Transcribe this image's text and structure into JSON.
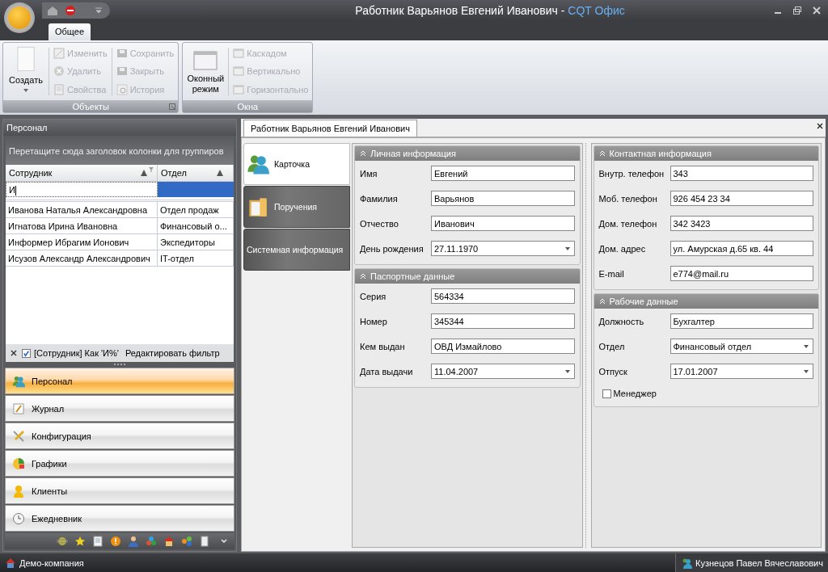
{
  "window": {
    "title": "Работник Варьянов Евгений Иванович - ",
    "app_name": "CQT Офис"
  },
  "ribbon": {
    "tabs": [
      {
        "label": "Общее",
        "selected": true
      }
    ],
    "groups": [
      {
        "label": "Объекты",
        "large": [
          {
            "label": "Создать",
            "disabled": false
          }
        ],
        "columns": [
          [
            {
              "label": "Изменить",
              "disabled": true,
              "kind": "edit"
            },
            {
              "label": "Удалить",
              "disabled": true,
              "kind": "delete"
            },
            {
              "label": "Свойства",
              "disabled": true,
              "kind": "props"
            }
          ],
          [
            {
              "label": "Сохранить",
              "disabled": true,
              "kind": "save"
            },
            {
              "label": "Закрыть",
              "disabled": true,
              "kind": "save"
            },
            {
              "label": "История",
              "disabled": true,
              "kind": "history"
            }
          ]
        ]
      },
      {
        "label": "Окна",
        "large": [
          {
            "label": "Оконный режим",
            "disabled": false
          }
        ],
        "columns": [
          [
            {
              "label": "Каскадом",
              "disabled": true,
              "kind": "window"
            },
            {
              "label": "Вертикально",
              "disabled": true,
              "kind": "window"
            },
            {
              "label": "Горизонтально",
              "disabled": true,
              "kind": "window"
            }
          ]
        ]
      }
    ]
  },
  "left_panel": {
    "title": "Персонал",
    "group_hint": "Перетащите сюда заголовок колонки для группиров",
    "columns": [
      {
        "label": "Сотрудник"
      },
      {
        "label": "Отдел"
      }
    ],
    "filter_row": [
      {
        "value": "И",
        "selected": false
      },
      {
        "selected": true
      }
    ],
    "rows": [
      [
        "Иванова Наталья Александровна",
        "Отдел продаж"
      ],
      [
        "Игнатова Ирина Ивановна",
        "Финансовый о..."
      ],
      [
        "Информер Ибрагим Ионович",
        "Экспедиторы"
      ],
      [
        "Исузов Александр Александрович",
        "IT-отдел"
      ]
    ],
    "filter_bar": {
      "checked": true,
      "text": "[Сотрудник] Как 'И%'",
      "edit_link": "Редактировать фильтр"
    },
    "nav": [
      {
        "label": "Персонал",
        "selected": true,
        "kind": "people"
      },
      {
        "label": "Журнал",
        "selected": false,
        "kind": "journal"
      },
      {
        "label": "Конфигурация",
        "selected": false,
        "kind": "tools"
      },
      {
        "label": "Графики",
        "selected": false,
        "kind": "chart"
      },
      {
        "label": "Клиенты",
        "selected": false,
        "kind": "person"
      },
      {
        "label": "Ежедневник",
        "selected": false,
        "kind": "clock"
      }
    ]
  },
  "document": {
    "tab": "Работник Варьянов Евгений Иванович",
    "side_tabs": [
      {
        "label": "Карточка",
        "selected": true,
        "kind": "people"
      },
      {
        "label": "Поручения",
        "selected": false,
        "kind": "folder"
      },
      {
        "label": "Системная информация",
        "selected": false,
        "kind": "plain"
      }
    ],
    "columns": [
      [
        {
          "title": "Личная информация",
          "fields": [
            {
              "label": "Имя",
              "value": "Евгений",
              "kind": "text"
            },
            {
              "label": "Фамилия",
              "value": "Варьянов",
              "kind": "text"
            },
            {
              "label": "Отчество",
              "value": "Иванович",
              "kind": "text"
            },
            {
              "label": "День рождения",
              "value": "27.11.1970",
              "kind": "combo"
            }
          ]
        },
        {
          "title": "Паспортные данные",
          "fields": [
            {
              "label": "Серия",
              "value": "564334",
              "kind": "text"
            },
            {
              "label": "Номер",
              "value": "345344",
              "kind": "text"
            },
            {
              "label": "Кем выдан",
              "value": "ОВД Измайлово",
              "kind": "text"
            },
            {
              "label": "Дата выдачи",
              "value": "11.04.2007",
              "kind": "combo"
            }
          ]
        }
      ],
      [
        {
          "title": "Контактная информация",
          "fields": [
            {
              "label": "Внутр. телефон",
              "value": "343",
              "kind": "text"
            },
            {
              "label": "Моб. телефон",
              "value": "926 454 23 34",
              "kind": "text"
            },
            {
              "label": "Дом. телефон",
              "value": "342 3423",
              "kind": "text"
            },
            {
              "label": "Дом. адрес",
              "value": "ул. Амурская д.65 кв. 44",
              "kind": "text"
            },
            {
              "label": "E-mail",
              "value": "e774@mail.ru",
              "kind": "text"
            }
          ]
        },
        {
          "title": "Рабочие данные",
          "fields": [
            {
              "label": "Должность",
              "value": "Бухгалтер",
              "kind": "text"
            },
            {
              "label": "Отдел",
              "value": "Финансовый отдел",
              "kind": "combo"
            },
            {
              "label": "Отпуск",
              "value": "17.01.2007",
              "kind": "combo"
            },
            {
              "label": "Менеджер",
              "checked": false,
              "kind": "checkbox"
            }
          ]
        }
      ]
    ]
  },
  "status_bar": {
    "company": "Демо-компания",
    "user": "Кузнецов Павел Вячеславович"
  }
}
